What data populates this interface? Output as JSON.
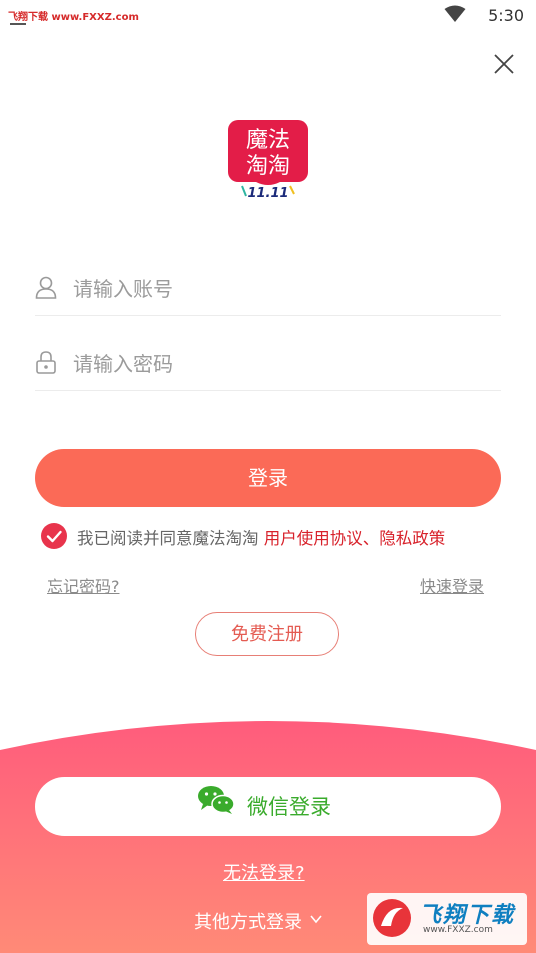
{
  "status_bar": {
    "time": "5:30",
    "watermark": "飞翔下载 www.FXXZ.com"
  },
  "logo": {
    "line1": "魔法",
    "line2": "淘淘",
    "badge": "11.11"
  },
  "form": {
    "account_placeholder": "请输入账号",
    "password_placeholder": "请输入密码",
    "login_label": "登录"
  },
  "agreement": {
    "prefix": "我已阅读并同意魔法淘淘 ",
    "user_agreement": "用户使用协议",
    "separator": "、",
    "privacy_policy": "隐私政策",
    "checked": true
  },
  "links": {
    "forgot_password": "忘记密码?",
    "quick_login": "快速登录"
  },
  "register_label": "免费注册",
  "bottom": {
    "wechat_label": "微信登录",
    "cant_login": "无法登录?",
    "other_methods": "其他方式登录"
  },
  "watermark_bottom": {
    "title": "飞翔下载",
    "url": "www.FXXZ.com"
  },
  "colors": {
    "accent": "#fb6a57",
    "check": "#e8344c",
    "link": "#d8222b",
    "wechat": "#3aab2c",
    "gradient_top": "#ff5c7c",
    "gradient_bottom": "#ff8a77"
  }
}
